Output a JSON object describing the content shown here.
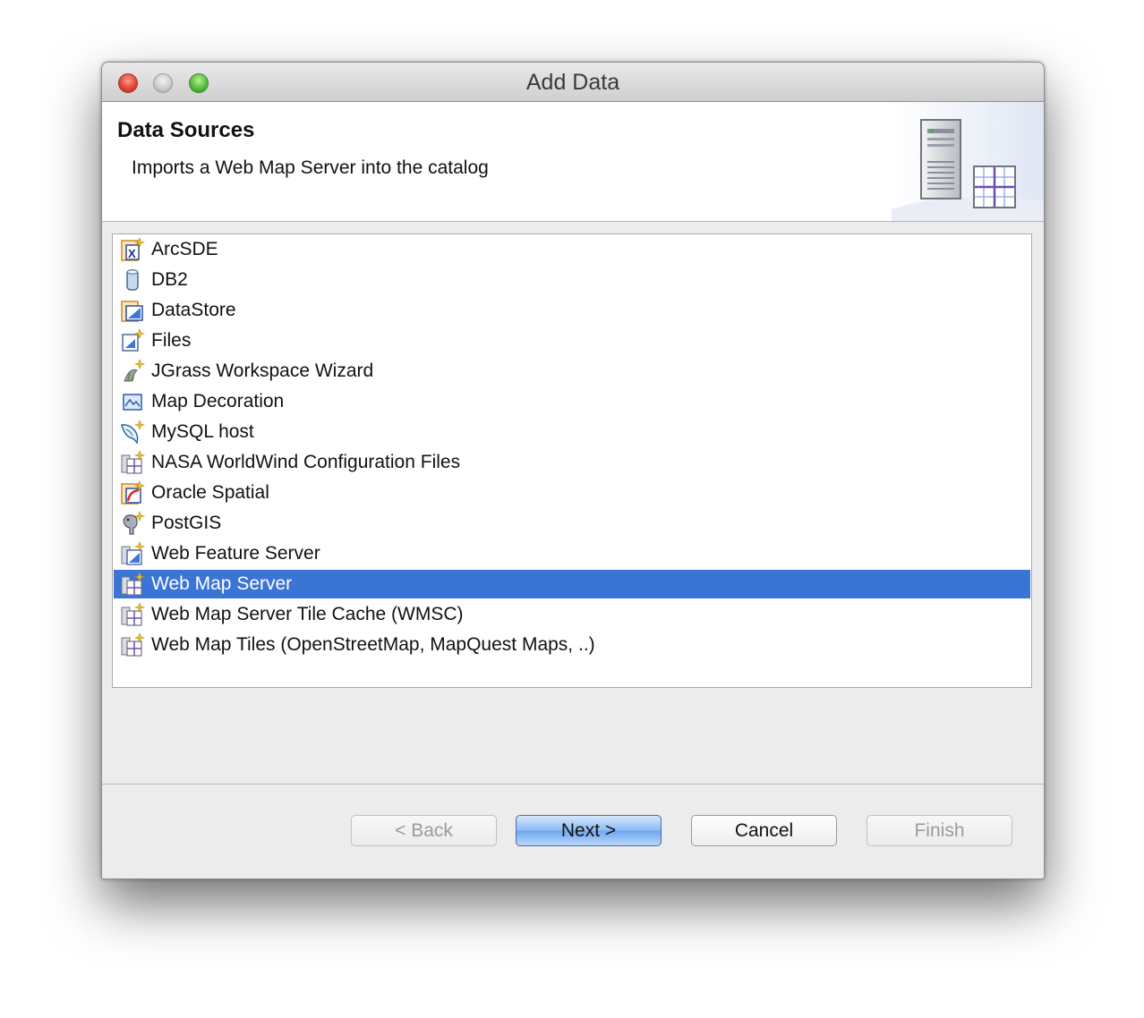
{
  "window": {
    "title": "Add Data"
  },
  "banner": {
    "title": "Data Sources",
    "description": "Imports a Web Map Server into the catalog",
    "icon": "server-grid-icon"
  },
  "list": {
    "selected_index": 11,
    "items": [
      {
        "label": "ArcSDE",
        "icon": "arcsde-icon"
      },
      {
        "label": "DB2",
        "icon": "db2-icon"
      },
      {
        "label": "DataStore",
        "icon": "datastore-icon"
      },
      {
        "label": "Files",
        "icon": "files-icon"
      },
      {
        "label": "JGrass Workspace Wizard",
        "icon": "jgrass-icon"
      },
      {
        "label": "Map Decoration",
        "icon": "map-decoration-icon"
      },
      {
        "label": "MySQL host",
        "icon": "mysql-icon"
      },
      {
        "label": "NASA WorldWind Configuration Files",
        "icon": "worldwind-icon"
      },
      {
        "label": "Oracle Spatial",
        "icon": "oracle-icon"
      },
      {
        "label": "PostGIS",
        "icon": "postgis-icon"
      },
      {
        "label": "Web Feature Server",
        "icon": "wfs-icon"
      },
      {
        "label": "Web Map Server",
        "icon": "wms-icon"
      },
      {
        "label": "Web Map Server Tile Cache (WMSC)",
        "icon": "wmsc-icon"
      },
      {
        "label": "Web Map Tiles (OpenStreetMap, MapQuest Maps, ..)",
        "icon": "web-map-tiles-icon"
      }
    ]
  },
  "buttons": {
    "back": "< Back",
    "next": "Next >",
    "cancel": "Cancel",
    "finish": "Finish"
  },
  "colors": {
    "selection": "#3a74d4",
    "default_button": "#8cbaf3"
  }
}
